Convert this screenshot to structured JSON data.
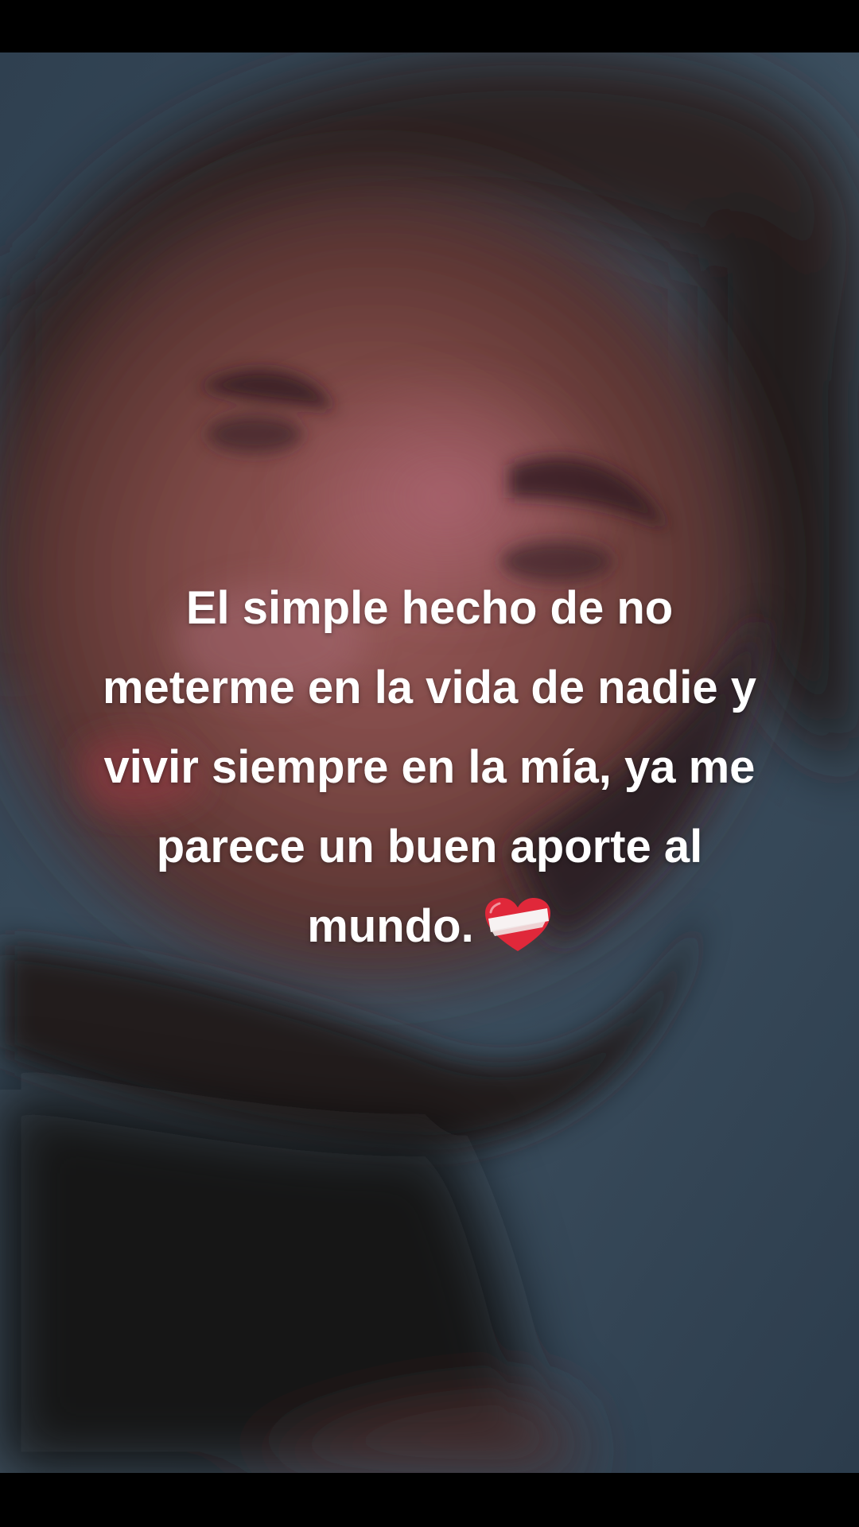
{
  "caption": {
    "lines": [
      "El simple hecho de no",
      "meterme en la vida de nadie y",
      "vivir siempre en la mía, ya me",
      "parece un buen aporte al",
      "mundo."
    ],
    "emoji_icon": "mending-heart-icon"
  },
  "colors": {
    "background_wall": "#3b4c5c",
    "skin": "#7a4a45",
    "hair": "#1e1a1c",
    "shirt": "#141415",
    "caption_text": "#ffffff",
    "heart_red": "#e0283a"
  }
}
